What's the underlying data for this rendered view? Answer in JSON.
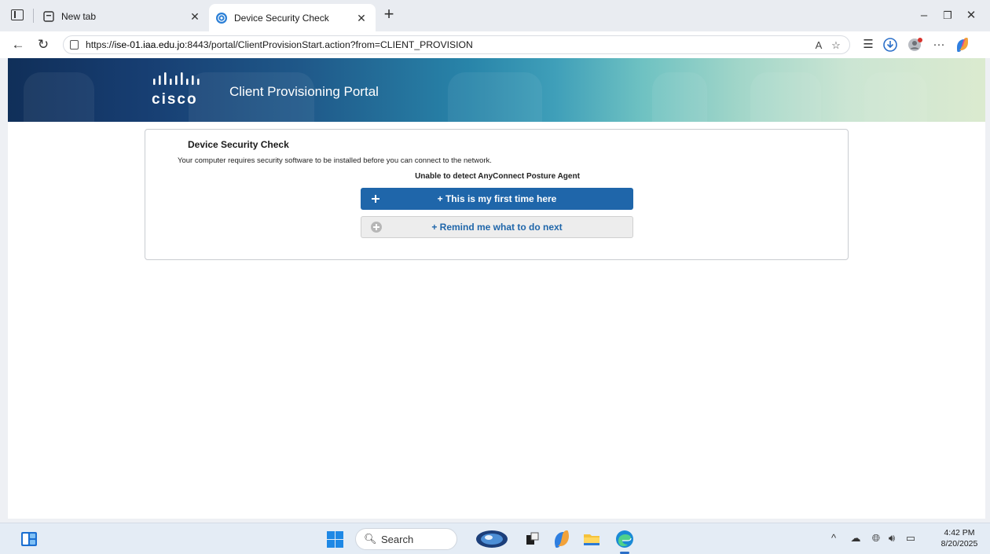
{
  "browser": {
    "tabs": [
      {
        "title": "New tab",
        "icon": "new-tab-icon",
        "active": false
      },
      {
        "title": "Device Security Check",
        "icon": "globe-icon",
        "active": true
      }
    ],
    "address": {
      "url_prefix": "https://",
      "url_host": "ise-01.iaa.edu.jo",
      "url_rest": ":8443/portal/ClientProvisionStart.action?from=CLIENT_PROVISION"
    }
  },
  "portal": {
    "brand": "cisco",
    "title": "Client Provisioning Portal",
    "card": {
      "heading": "Device Security Check",
      "description": "Your computer requires security software to be installed before you can connect to the network.",
      "status": "Unable to detect AnyConnect Posture Agent",
      "buttons": {
        "first_time": "+ This is my first time here",
        "remind": "+ Remind me what to do next"
      }
    }
  },
  "taskbar": {
    "search_label": "Search",
    "clock": {
      "time": "4:42 PM",
      "date": "8/20/2025"
    }
  }
}
